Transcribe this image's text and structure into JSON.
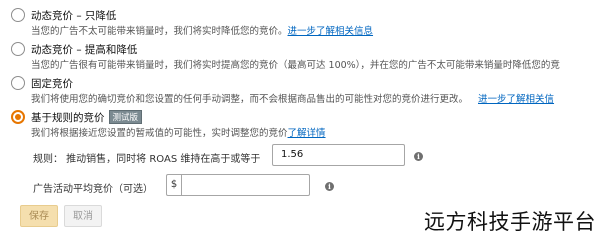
{
  "options": [
    {
      "title": "动态竞价 – 只降低",
      "desc": "当您的广告不太可能带来销量时，我们将实时降低您的竞价。",
      "link": "进一步了解相关信息",
      "selected": false
    },
    {
      "title": "动态竞价 – 提高和降低",
      "desc": "当您的广告很有可能带来销量时，我们将实时提高您的竞价（最高可达 100%），并在您的广告不太可能带来销量时降低您的竞",
      "selected": false
    },
    {
      "title": "固定竞价",
      "desc": "我们将使用您的确切竞价和您设置的任何手动调整，而不会根据商品售出的可能性对您的竞价进行更改。",
      "link": "进一步了解相关信",
      "selected": false
    },
    {
      "title": "基于规则的竞价",
      "badge": "测试版",
      "desc": "我们将根据接近您设置的暂戒值的可能性，实时调整您的竞价",
      "link": "了解详情",
      "selected": true
    }
  ],
  "rule": {
    "label": "规则：  推动销售，同时将 ROAS 维持在高于或等于",
    "value": "1.56"
  },
  "avg_roas": {
    "label": "广告活动平均竞价（可选）",
    "currency": "$",
    "value": ""
  },
  "buttons": {
    "save": "保存",
    "cancel": "取消"
  },
  "watermark": "远方科技手游平台",
  "colors": {
    "accent": "#e77600",
    "link": "#0066c0"
  }
}
